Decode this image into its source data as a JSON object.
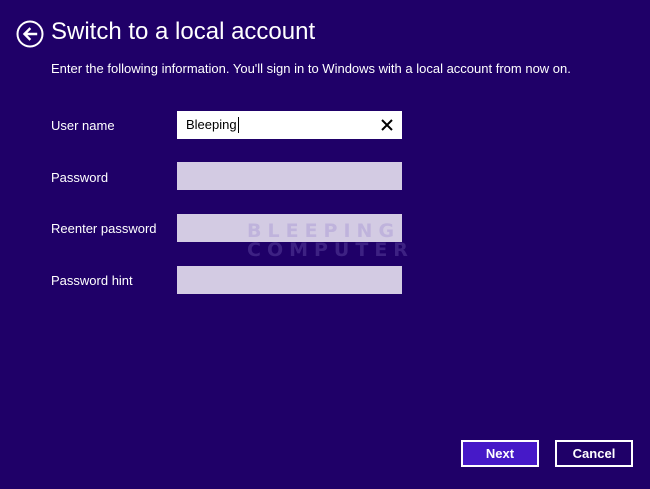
{
  "colors": {
    "background": "#1f0068",
    "input_inactive": "#d3cbe3",
    "next_button": "#4619c8",
    "text": "#ffffff"
  },
  "header": {
    "back_icon": "back-arrow-circle-icon",
    "title": "Switch to a local account",
    "subtitle": "Enter the following information. You'll sign in to Windows with a local account from now on."
  },
  "form": {
    "username": {
      "label": "User name",
      "value": "Bleeping",
      "clear_icon": "close-icon"
    },
    "password": {
      "label": "Password",
      "value": ""
    },
    "reenter_password": {
      "label": "Reenter password",
      "value": ""
    },
    "password_hint": {
      "label": "Password hint",
      "value": ""
    }
  },
  "watermark": {
    "line1": "BLEEPING",
    "line2": "COMPUTER"
  },
  "footer": {
    "next_label": "Next",
    "cancel_label": "Cancel"
  }
}
